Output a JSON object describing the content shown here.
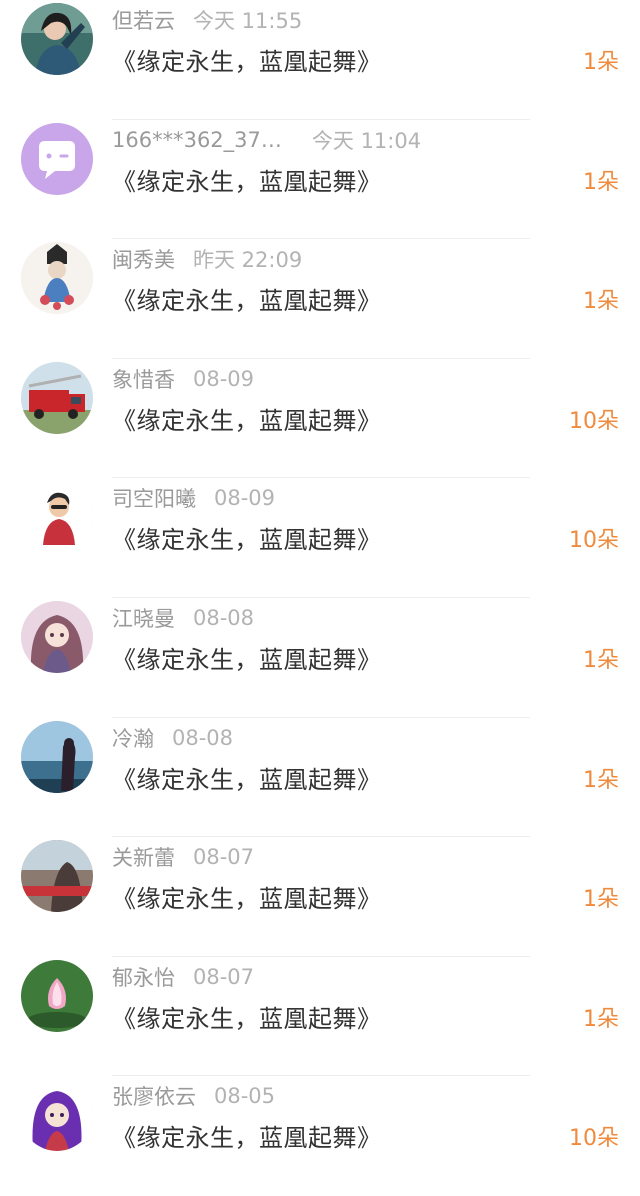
{
  "accent_color": "#f08a3c",
  "rows": [
    {
      "name": "但若云",
      "time": "今天 11:55",
      "title": "《缘定永生，蓝凰起舞》",
      "count": "1朵",
      "avatar": "woman-photo"
    },
    {
      "name": "166***362_37…",
      "time": "今天 11:04",
      "title": "《缘定永生，蓝凰起舞》",
      "count": "1朵",
      "avatar": "default-chat-avatar"
    },
    {
      "name": "闽秀美",
      "time": "昨天 22:09",
      "title": "《缘定永生，蓝凰起舞》",
      "count": "1朵",
      "avatar": "cartoon-avatar"
    },
    {
      "name": "象惜香",
      "time": "08-09",
      "title": "《缘定永生，蓝凰起舞》",
      "count": "10朵",
      "avatar": "fire-truck-avatar"
    },
    {
      "name": "司空阳曦",
      "time": "08-09",
      "title": "《缘定永生，蓝凰起舞》",
      "count": "10朵",
      "avatar": "cartoon-girl-avatar"
    },
    {
      "name": "江晓曼",
      "time": "08-08",
      "title": "《缘定永生，蓝凰起舞》",
      "count": "1朵",
      "avatar": "anime-girl-avatar"
    },
    {
      "name": "冷瀚",
      "time": "08-08",
      "title": "《缘定永生，蓝凰起舞》",
      "count": "1朵",
      "avatar": "seaside-girl-avatar"
    },
    {
      "name": "关新蕾",
      "time": "08-07",
      "title": "《缘定永生，蓝凰起舞》",
      "count": "1朵",
      "avatar": "photo-avatar"
    },
    {
      "name": "郁永怡",
      "time": "08-07",
      "title": "《缘定永生，蓝凰起舞》",
      "count": "1朵",
      "avatar": "lotus-avatar"
    },
    {
      "name": "张廖依云",
      "time": "08-05",
      "title": "《缘定永生，蓝凰起舞》",
      "count": "10朵",
      "avatar": "purple-anime-avatar"
    }
  ]
}
